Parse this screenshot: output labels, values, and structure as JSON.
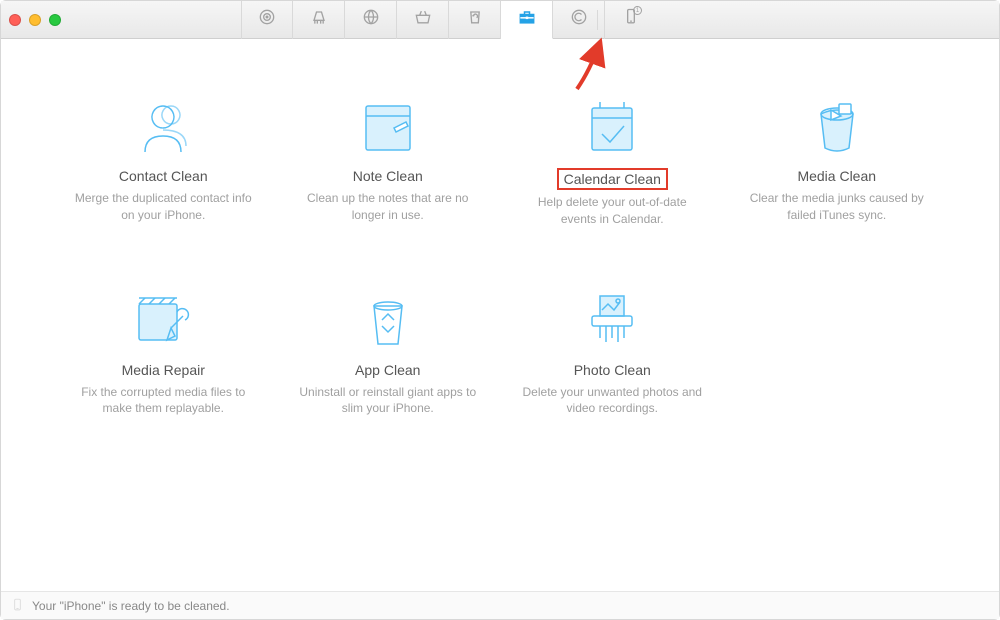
{
  "tabs": [
    {
      "name": "target-icon"
    },
    {
      "name": "broom-icon"
    },
    {
      "name": "globe-icon"
    },
    {
      "name": "basket-icon"
    },
    {
      "name": "recycle-icon"
    },
    {
      "name": "toolbox-icon",
      "active": true
    },
    {
      "name": "badge-c-icon"
    },
    {
      "name": "device-icon"
    }
  ],
  "tiles": [
    {
      "key": "contact",
      "title": "Contact Clean",
      "desc": "Merge the duplicated contact info on your iPhone."
    },
    {
      "key": "note",
      "title": "Note Clean",
      "desc": "Clean up the notes that are no longer in use."
    },
    {
      "key": "calendar",
      "title": "Calendar Clean",
      "desc": "Help delete your out-of-date events in Calendar.",
      "highlighted": true
    },
    {
      "key": "media",
      "title": "Media Clean",
      "desc": "Clear the media junks caused by failed iTunes sync."
    },
    {
      "key": "repair",
      "title": "Media Repair",
      "desc": "Fix the corrupted media files to make them replayable."
    },
    {
      "key": "app",
      "title": "App Clean",
      "desc": "Uninstall or reinstall giant apps to slim your iPhone."
    },
    {
      "key": "photo",
      "title": "Photo Clean",
      "desc": "Delete your unwanted photos and video recordings."
    }
  ],
  "status": {
    "text": "Your \"iPhone\" is ready to be cleaned."
  }
}
